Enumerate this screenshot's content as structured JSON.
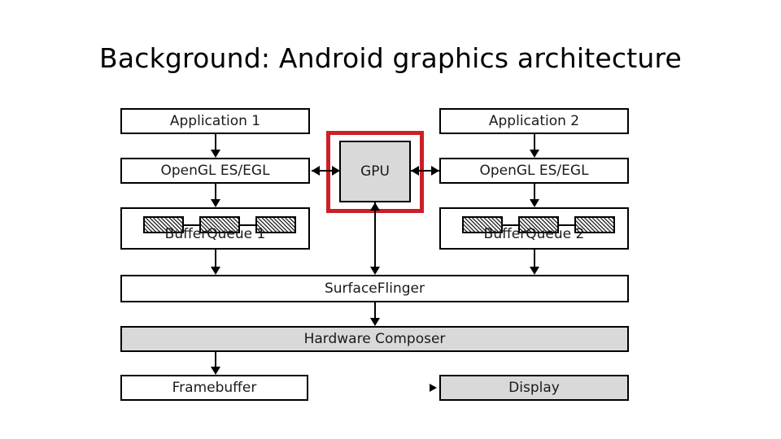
{
  "slide": {
    "title": "Background: Android graphics architecture"
  },
  "colors": {
    "highlight": "#CB2026",
    "node_fill": "#D9D9D9",
    "node_border": "#000000",
    "background": "#FFFFFF"
  },
  "diagram": {
    "nodes": [
      {
        "id": "application-1",
        "label": "Application 1",
        "fill": "white"
      },
      {
        "id": "application-2",
        "label": "Application 2",
        "fill": "white"
      },
      {
        "id": "opengl-left",
        "label": "OpenGL ES/EGL",
        "fill": "white"
      },
      {
        "id": "opengl-right",
        "label": "OpenGL ES/EGL",
        "fill": "white"
      },
      {
        "id": "gpu",
        "label": "GPU",
        "fill": "gray"
      },
      {
        "id": "bufferqueue-1",
        "label": "BufferQueue 1",
        "fill": "white"
      },
      {
        "id": "bufferqueue-2",
        "label": "BufferQueue 2",
        "fill": "white"
      },
      {
        "id": "surfaceflinger",
        "label": "SurfaceFlinger",
        "fill": "white"
      },
      {
        "id": "hardware-composer",
        "label": "Hardware Composer",
        "fill": "gray"
      },
      {
        "id": "framebuffer",
        "label": "Framebuffer",
        "fill": "white"
      },
      {
        "id": "display",
        "label": "Display",
        "fill": "gray"
      }
    ],
    "buffer_count_per_queue": 3,
    "edges": [
      {
        "from": "application-1",
        "to": "opengl-left",
        "type": "arrow-down"
      },
      {
        "from": "application-2",
        "to": "opengl-right",
        "type": "arrow-down"
      },
      {
        "from": "opengl-left",
        "to": "gpu",
        "type": "double-arrow-horizontal"
      },
      {
        "from": "opengl-right",
        "to": "gpu",
        "type": "double-arrow-horizontal"
      },
      {
        "from": "opengl-left",
        "to": "bufferqueue-1",
        "type": "arrow-down"
      },
      {
        "from": "opengl-right",
        "to": "bufferqueue-2",
        "type": "arrow-down"
      },
      {
        "from": "bufferqueue-1",
        "to": "surfaceflinger",
        "type": "arrow-down"
      },
      {
        "from": "bufferqueue-2",
        "to": "surfaceflinger",
        "type": "arrow-down"
      },
      {
        "from": "gpu",
        "to": "surfaceflinger",
        "type": "double-arrow-vertical"
      },
      {
        "from": "surfaceflinger",
        "to": "hardware-composer",
        "type": "arrow-down"
      },
      {
        "from": "hardware-composer",
        "to": "framebuffer",
        "type": "arrow-down"
      },
      {
        "from": "hardware-composer",
        "to": "display",
        "type": "arrow-right"
      }
    ],
    "highlight": {
      "target": "gpu",
      "color": "#CB2026"
    }
  }
}
